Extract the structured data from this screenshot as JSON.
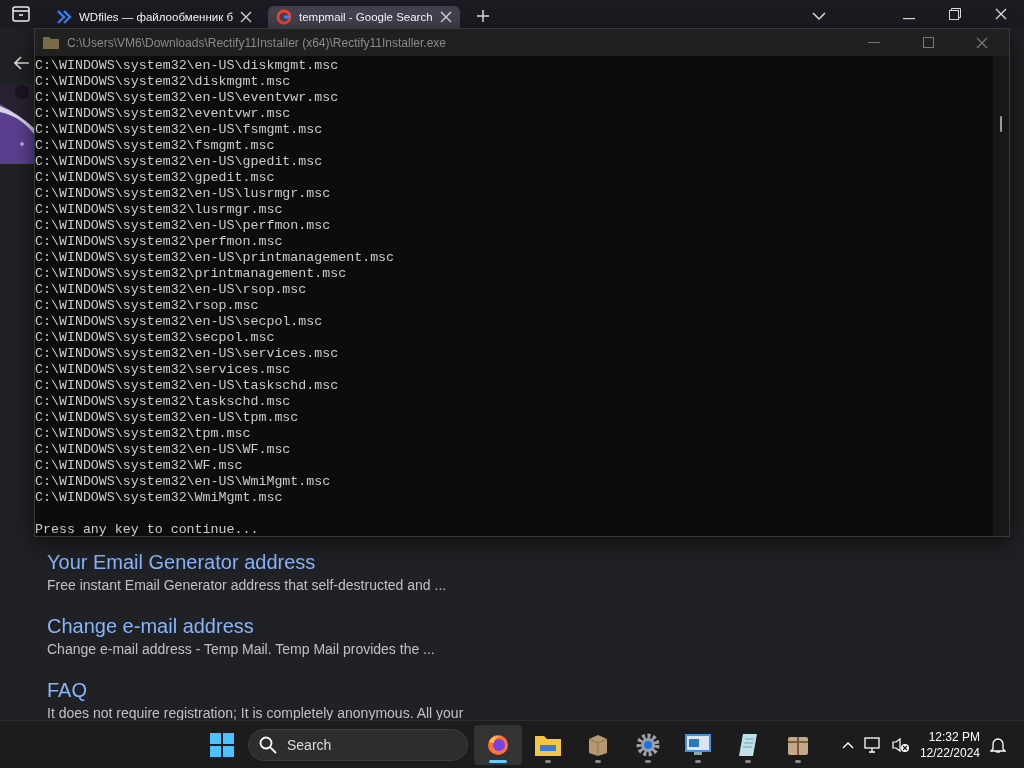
{
  "browser": {
    "tabs": [
      {
        "title": "WDfiles — файлообменник б",
        "selected": false,
        "kind": "chevrons"
      },
      {
        "title": "tempmail - Google Search",
        "selected": true,
        "kind": "google"
      }
    ]
  },
  "results": [
    {
      "title": "Your Email Generator address",
      "snippet": "Free instant Email Generator address that self-destructed and ..."
    },
    {
      "title": "Change e-mail address",
      "snippet": "Change e-mail address - Temp Mail. Temp Mail provides the ..."
    },
    {
      "title": "FAQ",
      "snippet": "It does not require registration;  It is completely anonymous. All your"
    }
  ],
  "console": {
    "title": "C:\\Users\\VM6\\Downloads\\Rectify11Installer (x64)\\Rectify11Installer.exe",
    "lines": [
      "C:\\WINDOWS\\system32\\en-US\\diskmgmt.msc",
      "C:\\WINDOWS\\system32\\diskmgmt.msc",
      "C:\\WINDOWS\\system32\\en-US\\eventvwr.msc",
      "C:\\WINDOWS\\system32\\eventvwr.msc",
      "C:\\WINDOWS\\system32\\en-US\\fsmgmt.msc",
      "C:\\WINDOWS\\system32\\fsmgmt.msc",
      "C:\\WINDOWS\\system32\\en-US\\gpedit.msc",
      "C:\\WINDOWS\\system32\\gpedit.msc",
      "C:\\WINDOWS\\system32\\en-US\\lusrmgr.msc",
      "C:\\WINDOWS\\system32\\lusrmgr.msc",
      "C:\\WINDOWS\\system32\\en-US\\perfmon.msc",
      "C:\\WINDOWS\\system32\\perfmon.msc",
      "C:\\WINDOWS\\system32\\en-US\\printmanagement.msc",
      "C:\\WINDOWS\\system32\\printmanagement.msc",
      "C:\\WINDOWS\\system32\\en-US\\rsop.msc",
      "C:\\WINDOWS\\system32\\rsop.msc",
      "C:\\WINDOWS\\system32\\en-US\\secpol.msc",
      "C:\\WINDOWS\\system32\\secpol.msc",
      "C:\\WINDOWS\\system32\\en-US\\services.msc",
      "C:\\WINDOWS\\system32\\services.msc",
      "C:\\WINDOWS\\system32\\en-US\\taskschd.msc",
      "C:\\WINDOWS\\system32\\taskschd.msc",
      "C:\\WINDOWS\\system32\\en-US\\tpm.msc",
      "C:\\WINDOWS\\system32\\tpm.msc",
      "C:\\WINDOWS\\system32\\en-US\\WF.msc",
      "C:\\WINDOWS\\system32\\WF.msc",
      "C:\\WINDOWS\\system32\\en-US\\WmiMgmt.msc",
      "C:\\WINDOWS\\system32\\WmiMgmt.msc"
    ],
    "prompt": "Press any key to continue..."
  },
  "taskbar": {
    "search": {
      "placeholder": "Search"
    },
    "apps": [
      {
        "kind": "firefox",
        "selected": true
      },
      {
        "kind": "folder",
        "selected": false
      },
      {
        "kind": "package",
        "selected": false
      },
      {
        "kind": "gear",
        "selected": false
      },
      {
        "kind": "monitor",
        "selected": false
      },
      {
        "kind": "notepad",
        "selected": false
      },
      {
        "kind": "box",
        "selected": false
      }
    ],
    "time": "12:32 PM",
    "date": "12/22/2024"
  }
}
